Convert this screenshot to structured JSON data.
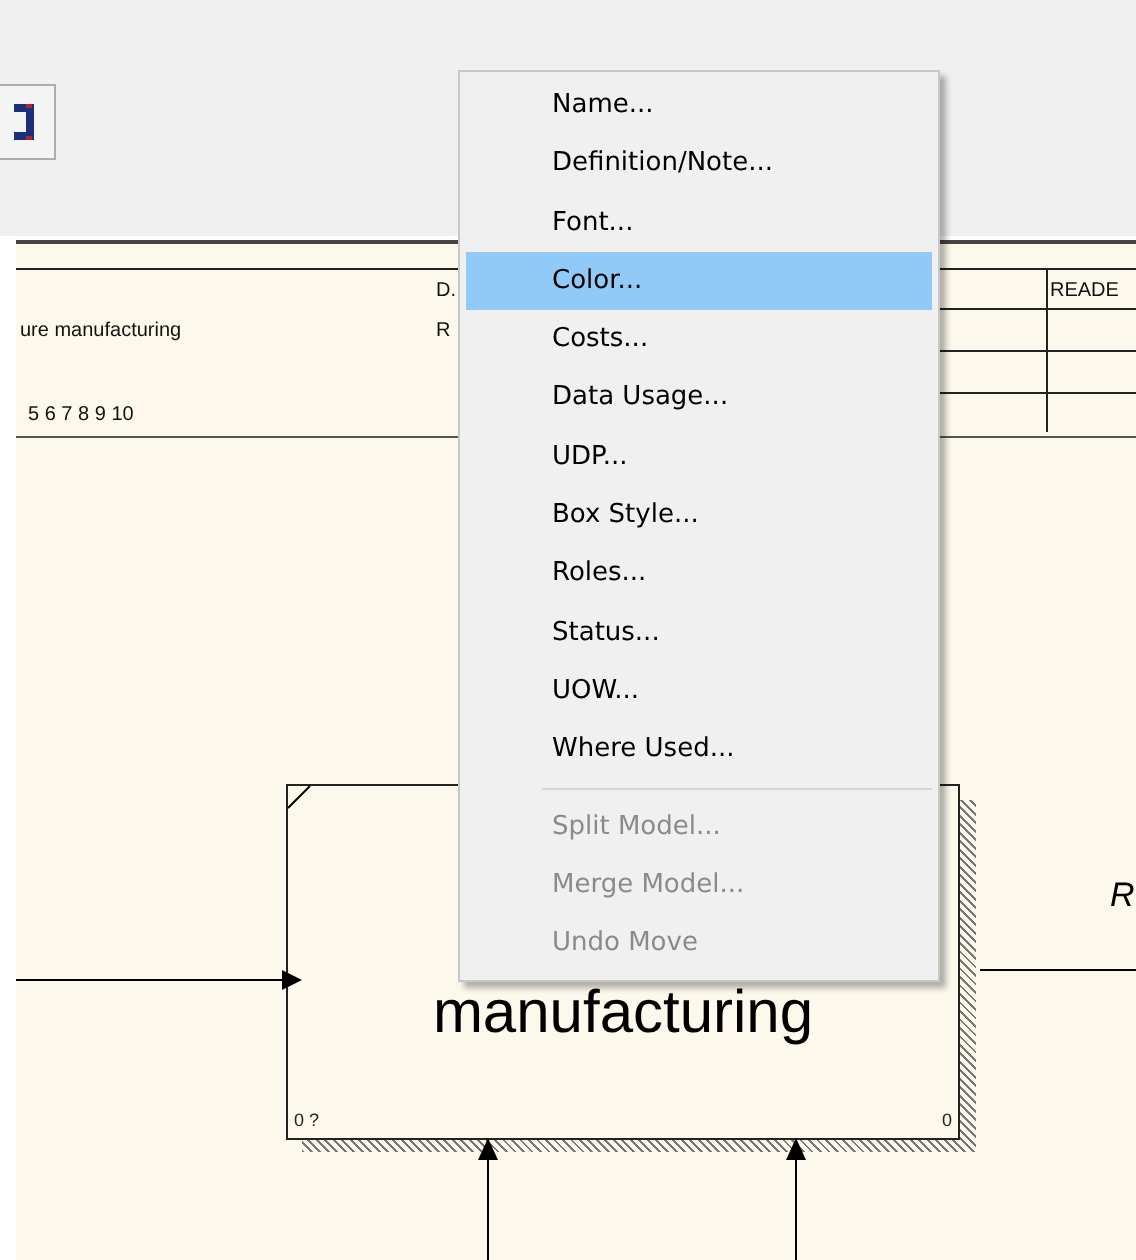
{
  "title_block": {
    "title": "ure manufacturing",
    "numbers": "5 6 7 8 9 10",
    "label_1": "D.",
    "label_2": "R",
    "column_header": "READE"
  },
  "activity_box": {
    "name": "manufacturing",
    "node_ref": "0 ?",
    "cost": "0"
  },
  "arrow_label": "R",
  "context_menu": {
    "items": [
      {
        "kind": "item",
        "label": "Name...",
        "selected": false,
        "disabled": false
      },
      {
        "kind": "item",
        "label": "Definition/Note...",
        "selected": false,
        "disabled": false
      },
      {
        "kind": "item",
        "label": "Font...",
        "selected": false,
        "disabled": false
      },
      {
        "kind": "item",
        "label": "Color...",
        "selected": true,
        "disabled": false
      },
      {
        "kind": "item",
        "label": "Costs...",
        "selected": false,
        "disabled": false
      },
      {
        "kind": "item",
        "label": "Data Usage...",
        "selected": false,
        "disabled": false
      },
      {
        "kind": "item",
        "label": "UDP...",
        "selected": false,
        "disabled": false
      },
      {
        "kind": "item",
        "label": "Box Style...",
        "selected": false,
        "disabled": false
      },
      {
        "kind": "item",
        "label": "Roles...",
        "selected": false,
        "disabled": false
      },
      {
        "kind": "item",
        "label": "Status...",
        "selected": false,
        "disabled": false
      },
      {
        "kind": "item",
        "label": "UOW...",
        "selected": false,
        "disabled": false
      },
      {
        "kind": "item",
        "label": "Where Used...",
        "selected": false,
        "disabled": false
      },
      {
        "kind": "separator"
      },
      {
        "kind": "item",
        "label": "Split Model...",
        "selected": false,
        "disabled": true
      },
      {
        "kind": "item",
        "label": "Merge Model...",
        "selected": false,
        "disabled": true
      },
      {
        "kind": "item",
        "label": "Undo Move",
        "selected": false,
        "disabled": true
      }
    ]
  }
}
